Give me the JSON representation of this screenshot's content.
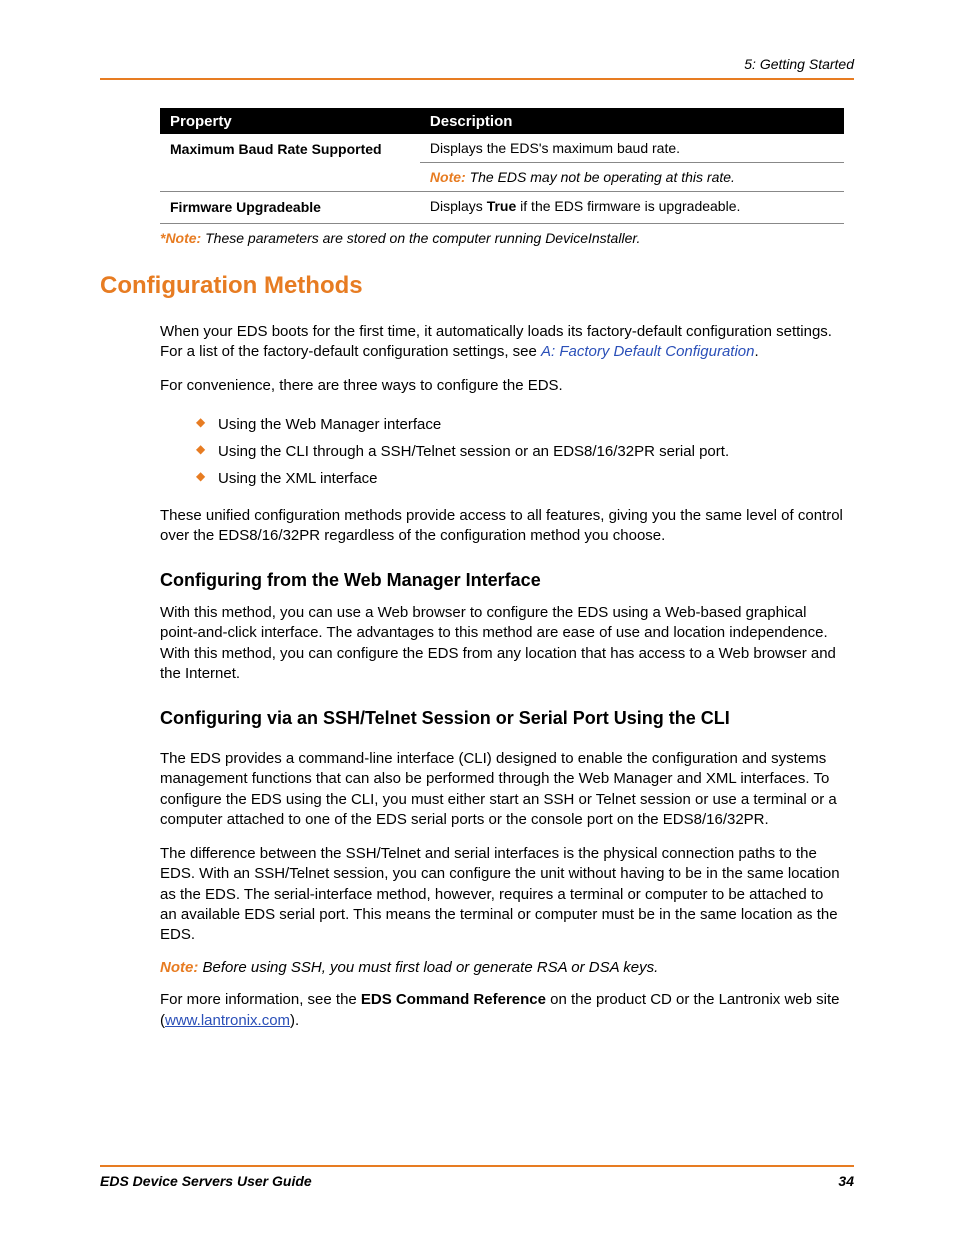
{
  "header": {
    "breadcrumb": "5: Getting Started"
  },
  "table": {
    "col1": "Property",
    "col2": "Description",
    "rows": [
      {
        "prop": "Maximum Baud Rate Supported",
        "desc1": "Displays the EDS's maximum baud rate.",
        "noteLabel": "Note:",
        "noteText": " The EDS may not be operating at this rate."
      },
      {
        "prop": "Firmware Upgradeable",
        "descPrefix": "Displays ",
        "descBold": "True",
        "descSuffix": " if the EDS firmware is upgradeable."
      }
    ],
    "footnoteLabel": "*Note:",
    "footnoteText": " These parameters are stored on the computer running DeviceInstaller."
  },
  "section": {
    "title": "Configuration Methods",
    "intro1a": "When your EDS boots for the first time, it automatically loads its factory-default configuration settings. For a list of the factory-default configuration settings, see ",
    "introLink": "A: Factory Default Configuration",
    "intro1b": ".",
    "intro2": "For convenience, there are three ways to configure the EDS.",
    "bullets": [
      "Using the Web Manager interface",
      "Using the CLI through a SSH/Telnet session or an EDS8/16/32PR serial port.",
      "Using the XML interface"
    ],
    "outro": "These unified configuration methods provide access to all features, giving you the same level of control over the EDS8/16/32PR regardless of the configuration method you choose."
  },
  "sub1": {
    "title": "Configuring from the Web Manager Interface",
    "body": "With this method, you can use a Web browser to configure the EDS using a Web-based graphical point-and-click interface. The advantages to this method are ease of use and location independence. With this method, you can configure the EDS from any location that has access to a Web browser and the Internet."
  },
  "sub2": {
    "title": "Configuring via an SSH/Telnet Session or Serial Port Using the CLI",
    "p1": "The EDS provides a command-line interface (CLI) designed to enable the configuration and systems management functions that can also be performed through the Web Manager and XML interfaces. To configure the EDS using the CLI, you must either start an SSH or Telnet session or use a terminal or a computer attached to one of the EDS serial ports or the console port on the EDS8/16/32PR.",
    "p2": "The difference between the SSH/Telnet and serial interfaces is the physical connection paths to the EDS. With an SSH/Telnet session, you can configure the unit without having to be in the same location as the EDS. The serial-interface method, however, requires a terminal or computer to be attached to an available EDS serial port. This means the terminal or computer must be in the same location as the EDS.",
    "noteLabel": "Note:",
    "noteText": " Before using SSH, you must first load or generate RSA or DSA keys.",
    "p3a": "For more information, see the ",
    "p3bold": "EDS Command Reference",
    "p3b": " on the product CD or the Lantronix web site (",
    "p3link": "www.lantronix.com",
    "p3c": ")."
  },
  "footer": {
    "left": "EDS Device Servers User Guide",
    "right": "34"
  }
}
